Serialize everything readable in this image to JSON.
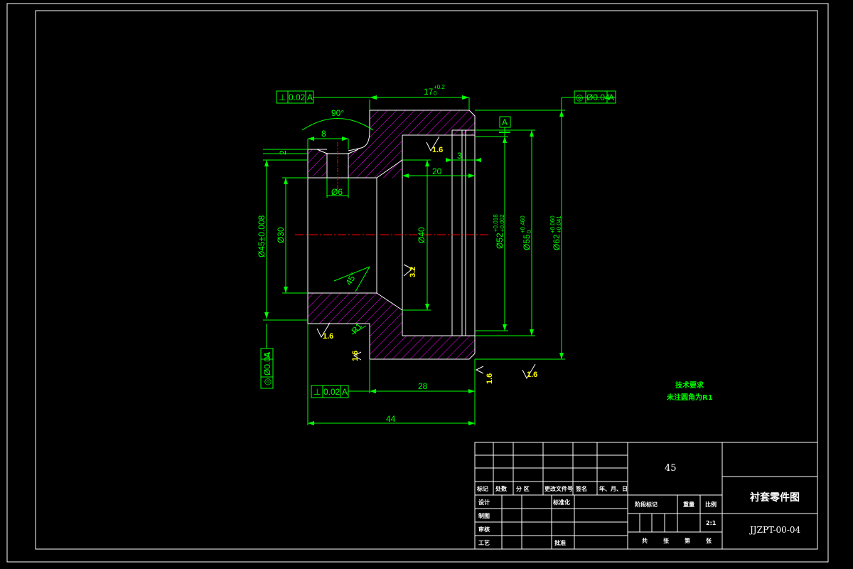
{
  "drawing": {
    "title": "衬套零件图",
    "material": "45",
    "drawing_number": "JJZPT-00-04",
    "scale": "2:1"
  },
  "technical_requirements": {
    "heading": "技术要求",
    "line1": "未注圆角为R1"
  },
  "dimensions": {
    "len_17": "17",
    "len_17_tol_upper": "+0.2",
    "len_17_tol_lower": "0",
    "angle_90": "90°",
    "w_8": "8",
    "d_2": "2",
    "d_3": "3",
    "d_20": "20",
    "dia_6": "Ø6",
    "dia_30": "Ø30",
    "dia_40": "Ø40",
    "dia_45": "Ø45±0.008",
    "dia_52": "Ø52",
    "dia_52_tol_upper": "+0.018",
    "dia_52_tol_lower": "+0.002",
    "dia_55": "Ø55",
    "dia_55_tol_upper": "+0.460",
    "dia_55_tol_lower": "0",
    "dia_62": "Ø62",
    "dia_62_tol_upper": "+0.060",
    "dia_62_tol_lower": "+0.041",
    "angle_45": "45°",
    "r1": "R1",
    "len_28": "28",
    "len_44": "44"
  },
  "gdt": {
    "perp_top": {
      "symbol": "⊥",
      "value": "0.02",
      "datum": "A"
    },
    "conc_top": {
      "symbol": "◎",
      "value": "Ø0.04",
      "datum": "A"
    },
    "conc_left": {
      "symbol": "◎",
      "value": "Ø0.04",
      "datum": "A"
    },
    "perp_bottom": {
      "symbol": "⊥",
      "value": "0.02",
      "datum": "A"
    },
    "datum_label": "A"
  },
  "roughness": [
    "1.6",
    "1.6",
    "3.2",
    "1.6",
    "1.6",
    "1.6"
  ],
  "title_block": {
    "row_headers": [
      "标记",
      "处数",
      "分 区",
      "更改文件号",
      "签名",
      "年、月、日"
    ],
    "design": "设计",
    "standardize": "标准化",
    "draw": "制图",
    "check": "审核",
    "process": "工艺",
    "approve": "批准",
    "stage_mark": "阶段标记",
    "weight": "重量",
    "scale_label": "比例",
    "total": "共",
    "sheet1": "张",
    "page": "第",
    "sheet2": "张"
  },
  "colors": {
    "outline": "#ffffff",
    "dimension": "#00ff00",
    "hatch": "#ff00ff",
    "centerline": "#ff0000",
    "roughness_text": "#ffff00"
  }
}
